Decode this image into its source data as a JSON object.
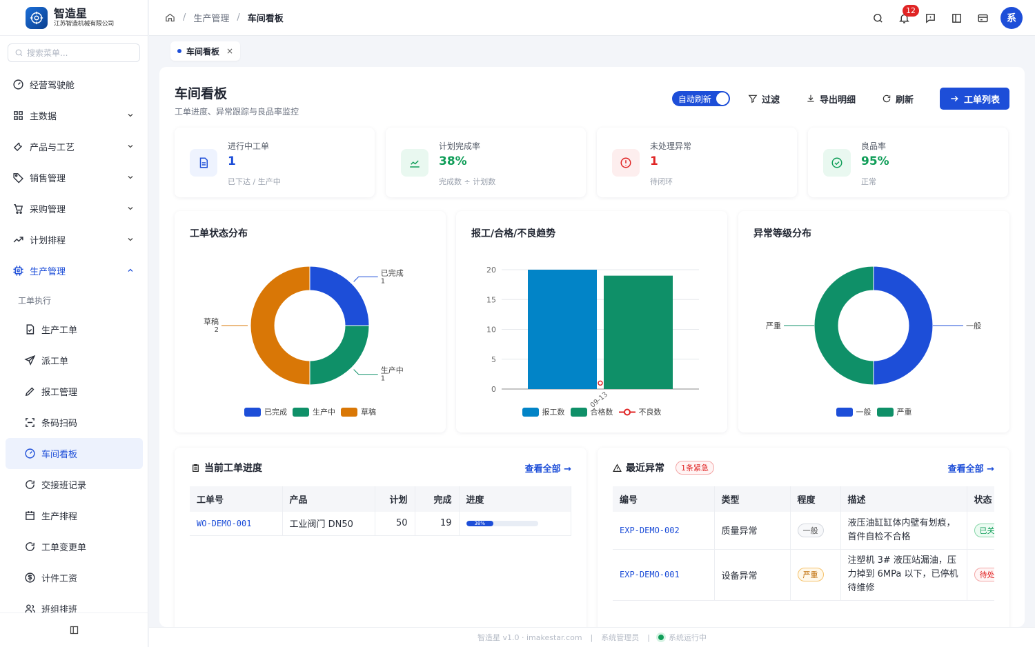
{
  "brand": {
    "name": "智造星",
    "company": "江苏智造机械有限公司"
  },
  "search": {
    "placeholder": "搜索菜单..."
  },
  "menu": {
    "items": [
      {
        "label": "经营驾驶舱",
        "icon": "dashboard-icon"
      },
      {
        "label": "主数据",
        "icon": "grid-icon"
      },
      {
        "label": "产品与工艺",
        "icon": "wrench-icon"
      },
      {
        "label": "销售管理",
        "icon": "tag-icon"
      },
      {
        "label": "采购管理",
        "icon": "cart-icon"
      },
      {
        "label": "计划排程",
        "icon": "trend-icon"
      },
      {
        "label": "生产管理",
        "icon": "chip-icon"
      }
    ],
    "group_label": "工单执行",
    "sub_items": [
      {
        "label": "生产工单",
        "icon": "file-check-icon"
      },
      {
        "label": "派工单",
        "icon": "send-icon"
      },
      {
        "label": "报工管理",
        "icon": "pencil-icon"
      },
      {
        "label": "条码扫码",
        "icon": "scan-icon"
      },
      {
        "label": "车间看板",
        "icon": "gauge-icon"
      },
      {
        "label": "交接班记录",
        "icon": "refresh-icon"
      },
      {
        "label": "生产排程",
        "icon": "calendar-icon"
      },
      {
        "label": "工单变更单",
        "icon": "refresh-icon"
      },
      {
        "label": "计件工资",
        "icon": "dollar-icon"
      },
      {
        "label": "班组排班",
        "icon": "users-icon"
      }
    ]
  },
  "header": {
    "crumbs": [
      "生产管理",
      "车间看板"
    ],
    "notifications": "12",
    "avatar": "系"
  },
  "tab": {
    "label": "车间看板",
    "close": "×"
  },
  "page": {
    "title": "车间看板",
    "subtitle": "工单进度、异常跟踪与良品率监控",
    "toggle": "自动刷新",
    "filter": "过滤",
    "export": "导出明细",
    "refresh": "刷新",
    "primary": "工单列表"
  },
  "kpis": [
    {
      "label": "进行中工单",
      "value": "1",
      "sub": "已下达 / 生产中",
      "color": "#1d4ed8",
      "icon": "document-icon"
    },
    {
      "label": "计划完成率",
      "value": "38%",
      "sub": "完成数 ÷ 计划数",
      "color": "#0f9d58",
      "icon": "chart-line-icon"
    },
    {
      "label": "未处理异常",
      "value": "1",
      "sub": "待闭环",
      "color": "#e02424",
      "icon": "alert-circle-icon"
    },
    {
      "label": "良品率",
      "value": "95%",
      "sub": "正常",
      "color": "#0f9d58",
      "icon": "check-circle-icon"
    }
  ],
  "charts": {
    "status_title": "工单状态分布",
    "trend_title": "报工/合格/不良趋势",
    "level_title": "异常等级分布"
  },
  "chart_data": [
    {
      "type": "pie",
      "title": "工单状态分布",
      "labels": [
        "已完成",
        "生产中",
        "草稿"
      ],
      "values": [
        1,
        1,
        2
      ],
      "colors": [
        "#1d4ed8",
        "#0f9068",
        "#d97706"
      ]
    },
    {
      "type": "bar",
      "title": "报工/合格/不良趋势",
      "categories": [
        "09-13"
      ],
      "series": [
        {
          "name": "报工数",
          "values": [
            20
          ],
          "color": "#0284c7"
        },
        {
          "name": "合格数",
          "values": [
            19
          ],
          "color": "#0f9068"
        },
        {
          "name": "不良数",
          "values": [
            1
          ],
          "color": "#e02424",
          "type": "line"
        }
      ],
      "ylim": [
        0,
        20
      ],
      "yticks": [
        0,
        5,
        10,
        15,
        20
      ]
    },
    {
      "type": "pie",
      "title": "异常等级分布",
      "labels": [
        "一般",
        "严重"
      ],
      "values": [
        1,
        1
      ],
      "colors": [
        "#1d4ed8",
        "#0f9068"
      ]
    }
  ],
  "orders": {
    "title": "当前工单进度",
    "see_all": "查看全部 →",
    "columns": [
      "工单号",
      "产品",
      "计划",
      "完成",
      "进度"
    ],
    "rows": [
      {
        "no": "WO-DEMO-001",
        "product": "工业阀门 DN50",
        "plan": "50",
        "done": "19",
        "progress": "38%",
        "progress_value": 0.38
      }
    ]
  },
  "exceptions": {
    "title": "最近异常",
    "urgent": "1条紧急",
    "see_all": "查看全部 →",
    "columns": [
      "编号",
      "类型",
      "程度",
      "描述",
      "状态"
    ],
    "rows": [
      {
        "no": "EXP-DEMO-002",
        "type": "质量异常",
        "level": "一般",
        "desc": "液压油缸缸体内壁有划痕，首件自检不合格",
        "status": "已关"
      },
      {
        "no": "EXP-DEMO-001",
        "type": "设备异常",
        "level": "严重",
        "desc": "注塑机 3# 液压站漏油，压力掉到 6MPa 以下，已停机待维修",
        "status": "待处"
      }
    ]
  },
  "footer": {
    "version": "智造星 v1.0 · imakestar.com",
    "user": "系统管理员",
    "status": "系统运行中"
  }
}
